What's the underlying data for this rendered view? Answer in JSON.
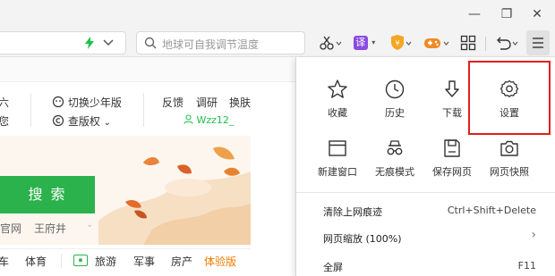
{
  "window": {
    "minimize_glyph": "—",
    "restore_glyph": "❐",
    "close_glyph": "✕"
  },
  "toolbar": {
    "search_placeholder": "地球可自我调节温度",
    "translate_label": "译"
  },
  "page": {
    "top_links": {
      "col1_a": "六",
      "col1_b": "您",
      "youth_mode": "切换少年版",
      "anti_copy": "查版权",
      "feedback": "反馈",
      "survey": "调研",
      "skin": "换肤",
      "username": "Wzz12_"
    },
    "search_button": "搜 索",
    "hot_links": [
      "官网",
      "王府井"
    ],
    "categories": [
      "车",
      "体育",
      "旅游",
      "军事",
      "房产",
      "体验版"
    ]
  },
  "menu": {
    "icons_row1": [
      {
        "label": "收藏",
        "icon": "star-icon"
      },
      {
        "label": "历史",
        "icon": "clock-icon"
      },
      {
        "label": "下载",
        "icon": "download-icon"
      },
      {
        "label": "设置",
        "icon": "gear-icon"
      }
    ],
    "icons_row2": [
      {
        "label": "新建窗口",
        "icon": "window-icon"
      },
      {
        "label": "无痕模式",
        "icon": "glasses-icon"
      },
      {
        "label": "保存网页",
        "icon": "save-icon"
      },
      {
        "label": "网页快照",
        "icon": "camera-icon"
      }
    ],
    "rows": [
      {
        "label": "清除上网痕迹",
        "right": "Ctrl+Shift+Delete"
      },
      {
        "label": "网页缩放 (100%)",
        "right": "›"
      },
      {
        "label": "全屏",
        "right": "F11"
      }
    ]
  },
  "colors": {
    "accent_green": "#1fbf4a",
    "search_green": "#2bb24c",
    "highlight_red": "#e0201b",
    "orange": "#f07a00"
  }
}
